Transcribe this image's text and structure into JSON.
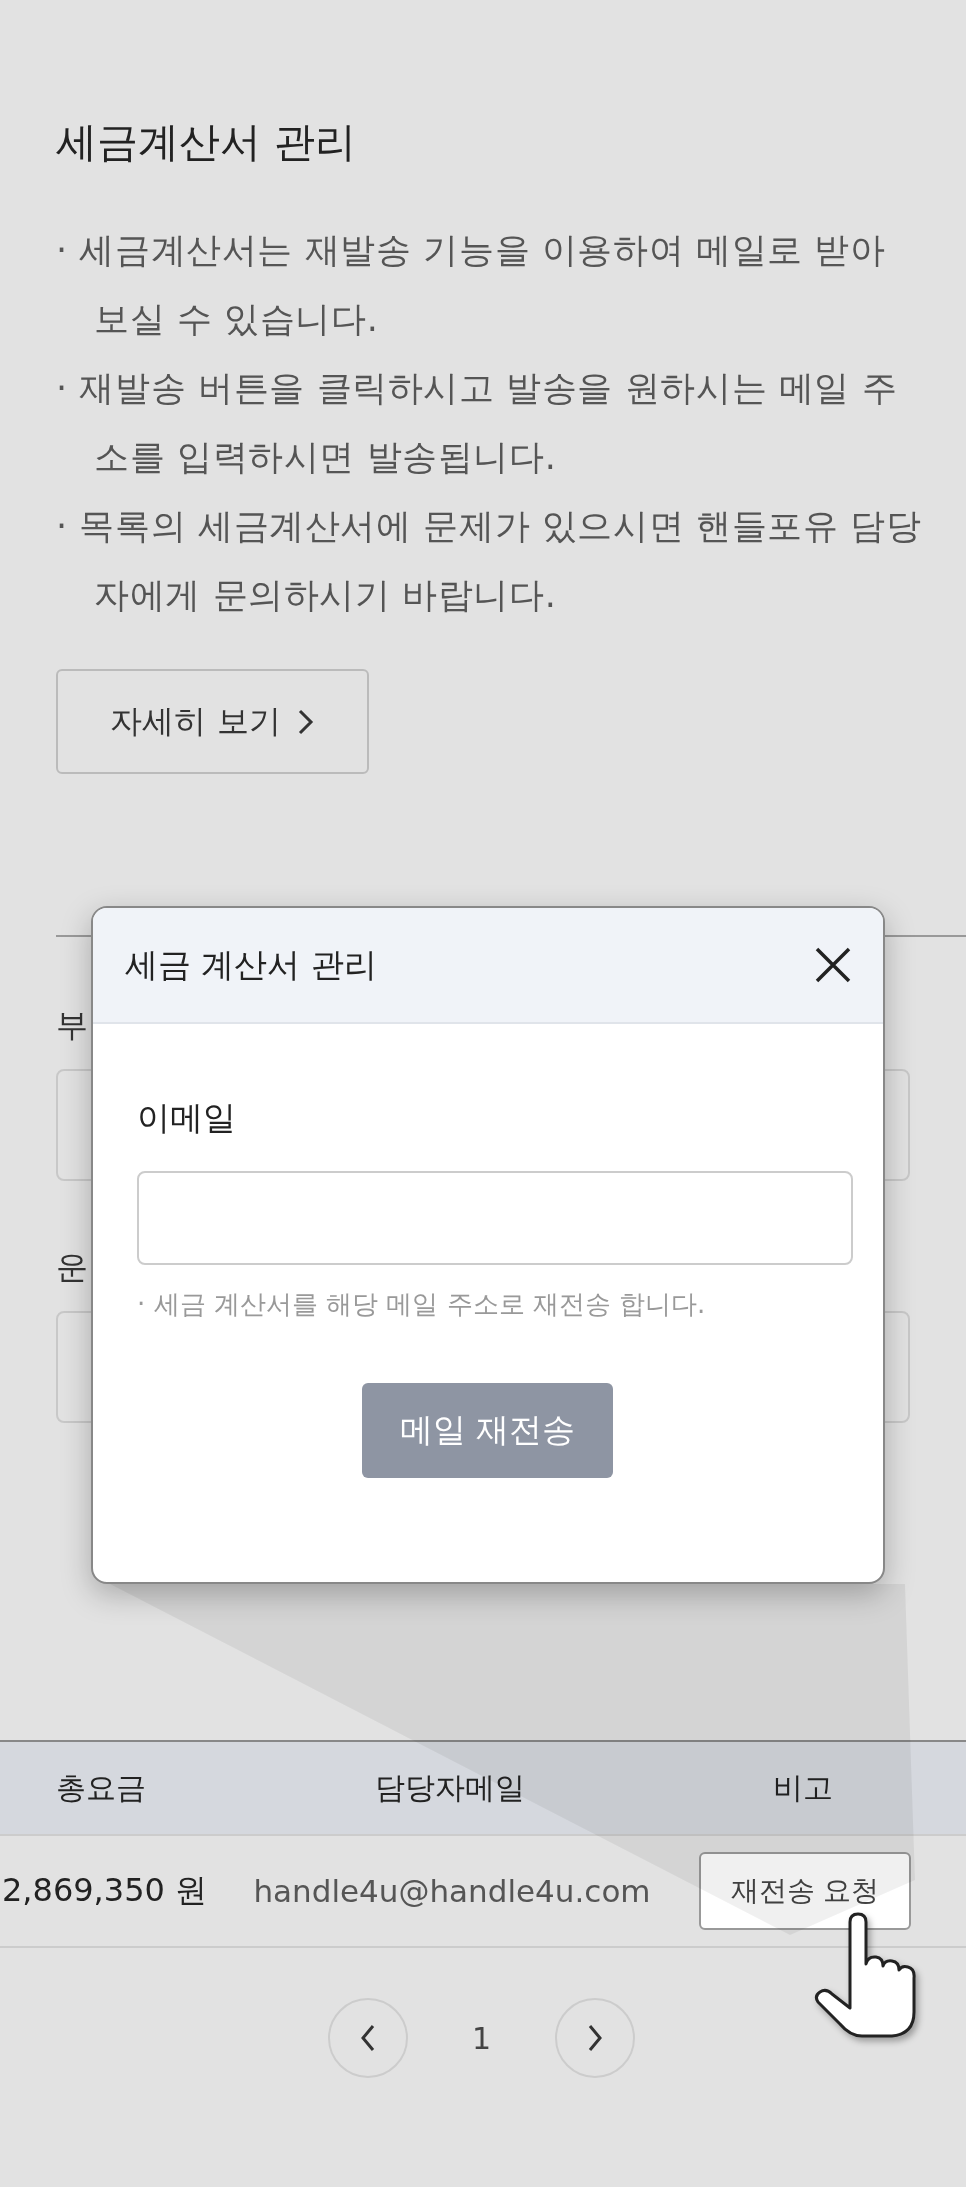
{
  "section": {
    "title": "세금계산서 관리",
    "notes": [
      "· 세금계산서는 재발송 기능을 이용하여 메일로 받아 보실 수 있습니다.",
      "· 재발송 버튼을 클릭하시고 발송을 원하시는 메일 주소를 입력하시면 발송됩니다.",
      "· 목록의 세금계산서에 문제가 있으시면 핸들포유 담당자에게 문의하시기 바랍니다."
    ],
    "detail_button": "자세히 보기"
  },
  "form": {
    "fields": [
      {
        "label": "부"
      },
      {
        "label": "운"
      }
    ]
  },
  "modal": {
    "title": "세금 계산서 관리",
    "email_label": "이메일",
    "hint": "· 세금 계산서를 해당 메일 주소로 재전송 합니다.",
    "submit": "메일 재전송"
  },
  "table": {
    "columns": [
      "총요금",
      "담당자메일",
      "비고"
    ],
    "rows": [
      {
        "total": "2,869,350 원",
        "email": "handle4u@handle4u.com",
        "action": "재전송 요청"
      }
    ]
  },
  "pagination": {
    "pages": [
      "1"
    ]
  }
}
